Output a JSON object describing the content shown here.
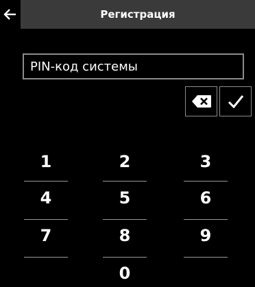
{
  "header": {
    "back_icon": "arrow-left-icon",
    "title": "Регистрация"
  },
  "pin_field": {
    "placeholder": "PIN-код системы",
    "value": ""
  },
  "actions": {
    "delete_icon": "backspace-icon",
    "confirm_icon": "checkmark-icon"
  },
  "keypad": {
    "keys": [
      {
        "label": "1"
      },
      {
        "label": "2"
      },
      {
        "label": "3"
      },
      {
        "label": "4"
      },
      {
        "label": "5"
      },
      {
        "label": "6"
      },
      {
        "label": "7"
      },
      {
        "label": "8"
      },
      {
        "label": "9"
      },
      {
        "label": "0"
      }
    ]
  },
  "colors": {
    "background": "#000000",
    "title_bar": "#3a3a3a",
    "border": "#8c8c8c",
    "text": "#ffffff"
  }
}
